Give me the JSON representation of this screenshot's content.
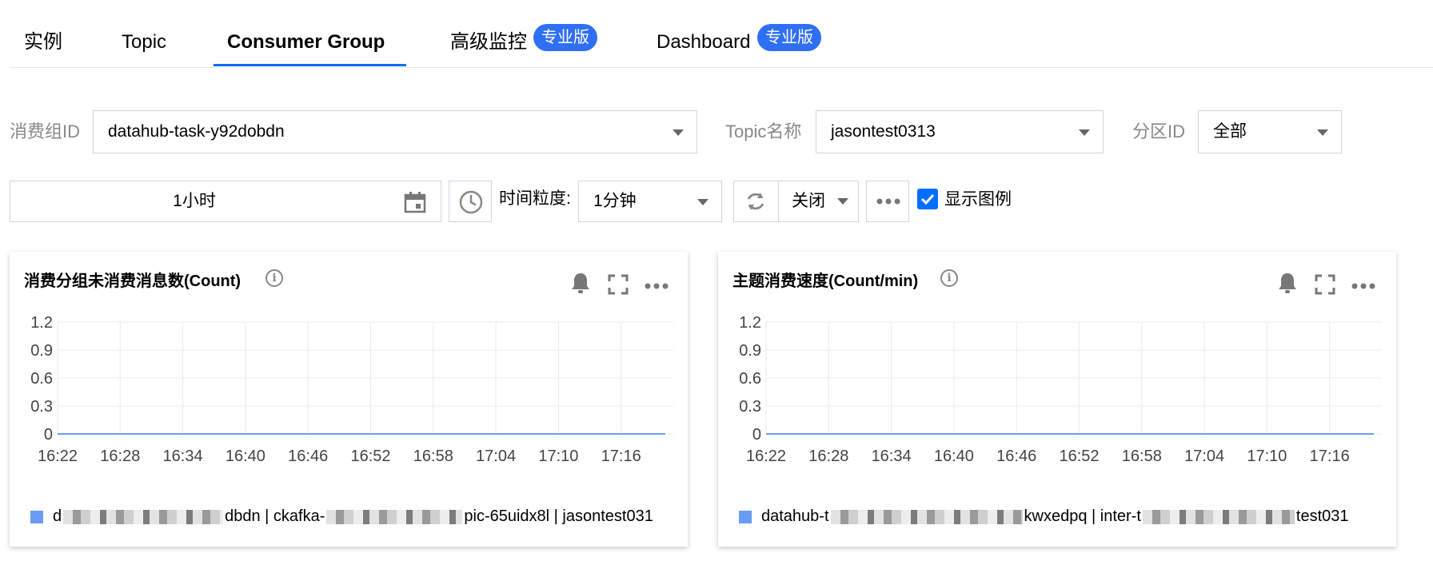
{
  "tabs": [
    {
      "label": "实例"
    },
    {
      "label": "Topic"
    },
    {
      "label": "Consumer Group",
      "active": true
    },
    {
      "label": "高级监控",
      "badge": "专业版"
    },
    {
      "label": "Dashboard",
      "badge": "专业版"
    }
  ],
  "filters": {
    "group_id_label": "消费组ID",
    "group_id_value": "datahub-task-y92dobdn",
    "topic_label": "Topic名称",
    "topic_value": "jasontest0313",
    "partition_label": "分区ID",
    "partition_value": "全部"
  },
  "toolbar": {
    "time_range": "1小时",
    "granularity_label": "时间粒度:",
    "granularity_value": "1分钟",
    "auto_refresh": "关闭",
    "show_legend_label": "显示图例",
    "show_legend_checked": true
  },
  "colors": {
    "accent": "#006eff",
    "badge": "#2f6ff5",
    "series": "#6b9cf5"
  },
  "cards": [
    {
      "title": "消费分组未消费消息数(Count)",
      "legend_parts": [
        "d",
        "dbdn | ckafka-",
        "pic-65uidx8l | jasontest031"
      ],
      "chart_data": {
        "type": "line",
        "x": [
          "16:22",
          "16:28",
          "16:34",
          "16:40",
          "16:46",
          "16:52",
          "16:58",
          "17:04",
          "17:10",
          "17:16"
        ],
        "yticks": [
          0,
          0.3,
          0.6,
          0.9,
          1.2
        ],
        "ylim": [
          0,
          1.2
        ],
        "series": [
          {
            "values": [
              0,
              0,
              0,
              0,
              0,
              0,
              0,
              0,
              0,
              0
            ]
          }
        ],
        "grid": true,
        "legend": "bottom-left"
      }
    },
    {
      "title": "主题消费速度(Count/min)",
      "legend_parts": [
        "datahub-t",
        "kwxedpq | inter-t",
        "test031"
      ],
      "chart_data": {
        "type": "line",
        "x": [
          "16:22",
          "16:28",
          "16:34",
          "16:40",
          "16:46",
          "16:52",
          "16:58",
          "17:04",
          "17:10",
          "17:16"
        ],
        "yticks": [
          0,
          0.3,
          0.6,
          0.9,
          1.2
        ],
        "ylim": [
          0,
          1.2
        ],
        "series": [
          {
            "values": [
              0,
              0,
              0,
              0,
              0,
              0,
              0,
              0,
              0,
              0
            ]
          }
        ],
        "grid": true,
        "legend": "bottom-left"
      }
    }
  ]
}
